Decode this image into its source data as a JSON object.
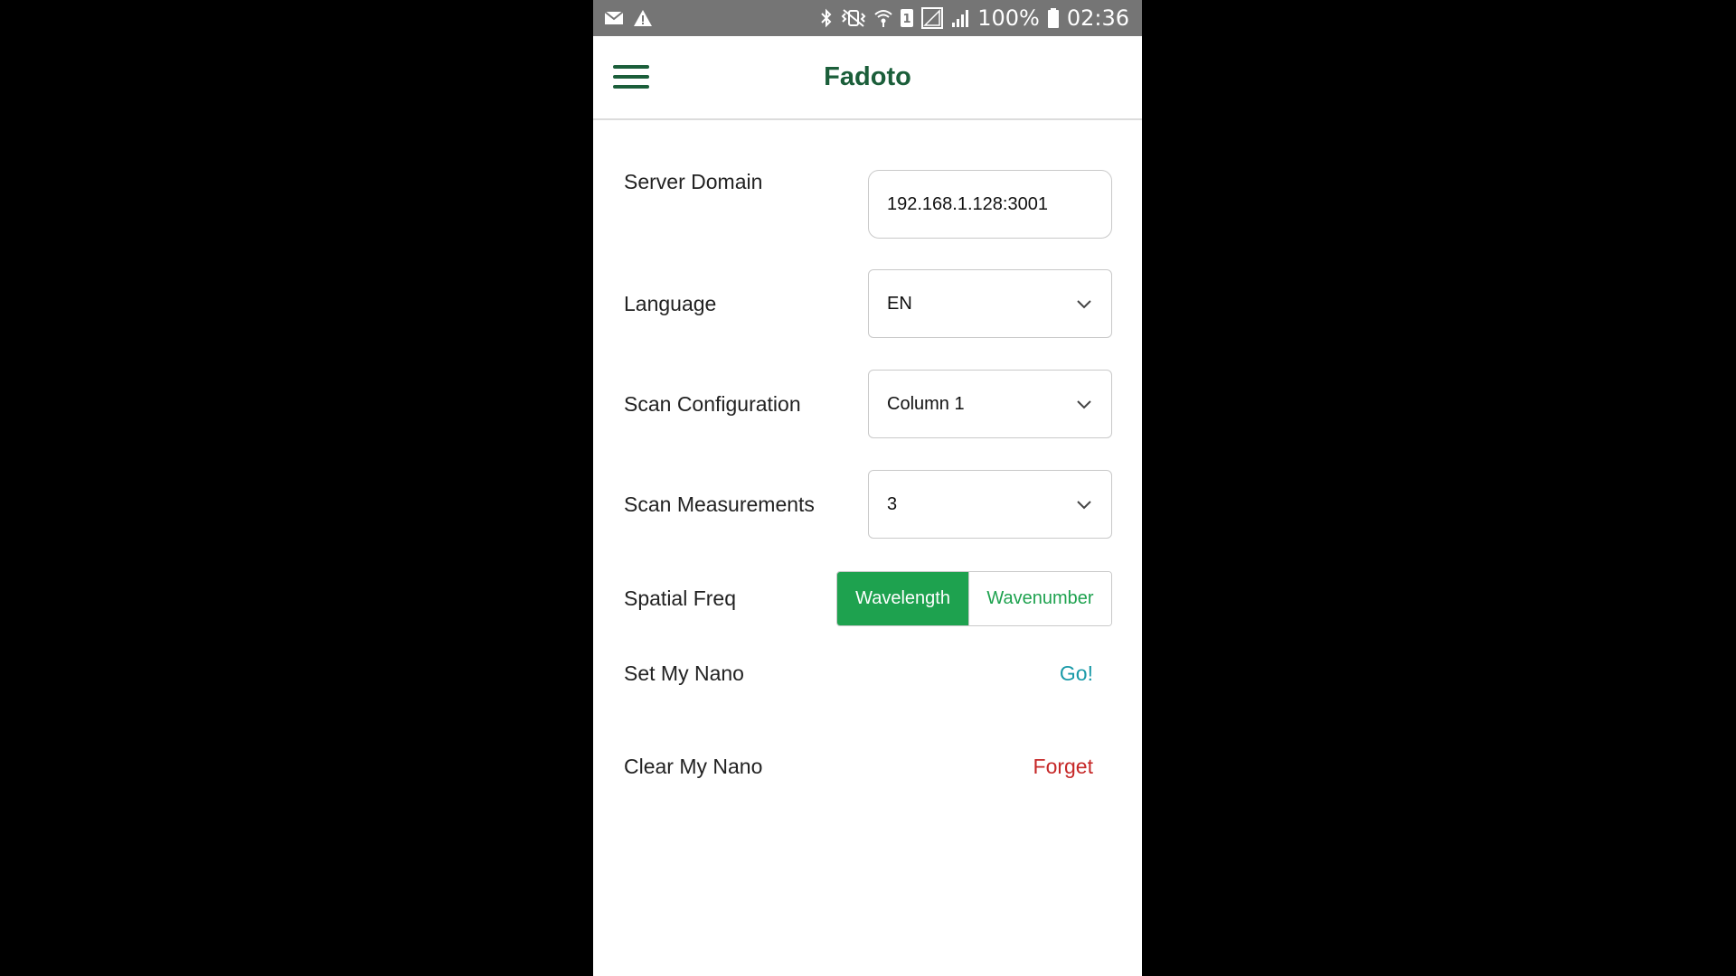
{
  "status_bar": {
    "battery": "100%",
    "time": "02:36",
    "icons_left": [
      "mail-icon",
      "warning-icon"
    ],
    "icons_right": [
      "bluetooth-icon",
      "vibrate-icon",
      "wifi-icon",
      "sim-1-icon",
      "signal-empty-icon",
      "signal-icon",
      "battery-icon"
    ]
  },
  "app_bar": {
    "title": "Fadoto",
    "menu_icon": "hamburger-menu-icon"
  },
  "settings": {
    "server_domain": {
      "label": "Server Domain",
      "value": "192.168.1.128:3001"
    },
    "language": {
      "label": "Language",
      "selected": "EN"
    },
    "scan_configuration": {
      "label": "Scan Configuration",
      "selected": "Column 1"
    },
    "scan_measurements": {
      "label": "Scan Measurements",
      "selected": "3"
    },
    "spatial_freq": {
      "label": "Spatial Freq",
      "options": [
        "Wavelength",
        "Wavenumber"
      ],
      "selected": "Wavelength"
    },
    "set_my_nano": {
      "label": "Set My Nano",
      "action": "Go!"
    },
    "clear_my_nano": {
      "label": "Clear My Nano",
      "action": "Forget"
    }
  },
  "colors": {
    "brand_dark_green": "#1b5e3a",
    "accent_green": "#1ea24f",
    "link_teal": "#1a9aa8",
    "danger_red": "#c62828",
    "status_bar_gray": "#757575"
  }
}
